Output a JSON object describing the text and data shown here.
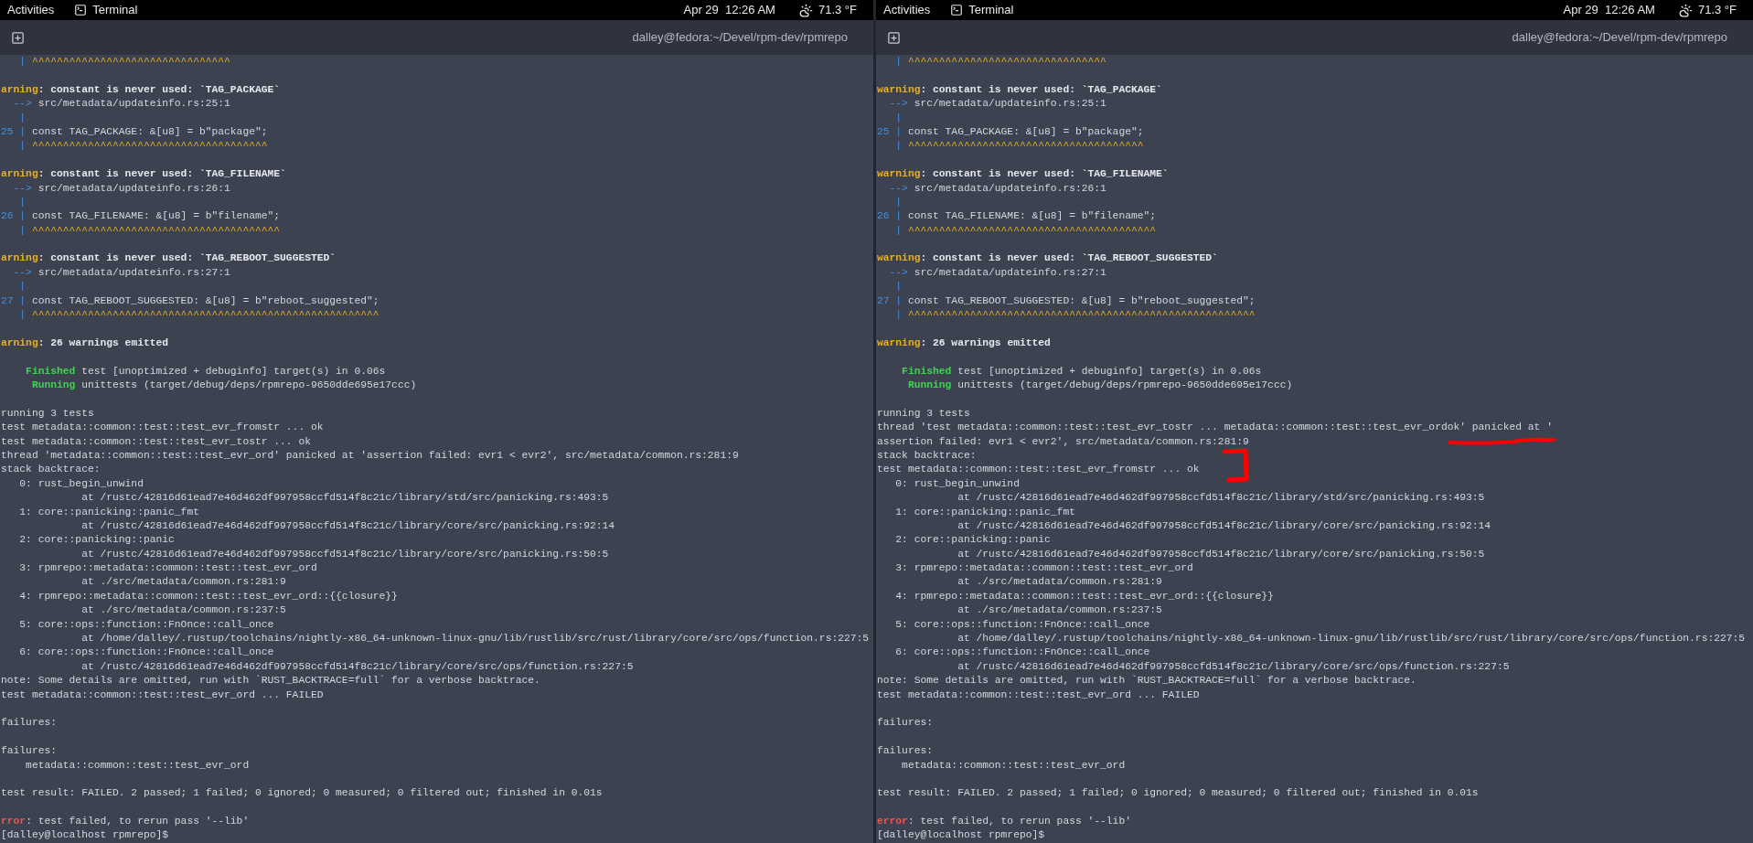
{
  "panes": [
    {
      "top_bar": {
        "activities": "Activities",
        "app": "Terminal",
        "datetime": "Apr 29  12:26 AM",
        "weather": "71.3 °F"
      },
      "header": {
        "title": "dalley@fedora:~/Devel/rpm-dev/rpmrepo"
      },
      "lines": [
        {
          "kind": "rich",
          "segments": [
            {
              "text": "   | ",
              "kind": "gutter"
            },
            {
              "text": "^^^^^^^^^^^^^^^^^^^^^^^^^^^^^^^^",
              "kind": "caret"
            }
          ]
        },
        {
          "kind": "blank"
        },
        {
          "kind": "rich",
          "segments": [
            {
              "text": "arning",
              "kind": "warning"
            },
            {
              "text": ": constant is never used: `TAG_PACKAGE`",
              "kind": "bold"
            }
          ]
        },
        {
          "kind": "rich",
          "segments": [
            {
              "text": "  -->",
              "kind": "gutter"
            },
            {
              "text": " src/metadata/updateinfo.rs:25:1",
              "kind": "plain"
            }
          ]
        },
        {
          "kind": "rich",
          "segments": [
            {
              "text": "   |",
              "kind": "gutter"
            }
          ]
        },
        {
          "kind": "rich",
          "segments": [
            {
              "text": "25 |",
              "kind": "gutter"
            },
            {
              "text": " const TAG_PACKAGE: &[u8] = b\"package\";",
              "kind": "plain"
            }
          ]
        },
        {
          "kind": "rich",
          "segments": [
            {
              "text": "   | ",
              "kind": "gutter"
            },
            {
              "text": "^^^^^^^^^^^^^^^^^^^^^^^^^^^^^^^^^^^^^^",
              "kind": "caret"
            }
          ]
        },
        {
          "kind": "blank"
        },
        {
          "kind": "rich",
          "segments": [
            {
              "text": "arning",
              "kind": "warning"
            },
            {
              "text": ": constant is never used: `TAG_FILENAME`",
              "kind": "bold"
            }
          ]
        },
        {
          "kind": "rich",
          "segments": [
            {
              "text": "  -->",
              "kind": "gutter"
            },
            {
              "text": " src/metadata/updateinfo.rs:26:1",
              "kind": "plain"
            }
          ]
        },
        {
          "kind": "rich",
          "segments": [
            {
              "text": "   |",
              "kind": "gutter"
            }
          ]
        },
        {
          "kind": "rich",
          "segments": [
            {
              "text": "26 |",
              "kind": "gutter"
            },
            {
              "text": " const TAG_FILENAME: &[u8] = b\"filename\";",
              "kind": "plain"
            }
          ]
        },
        {
          "kind": "rich",
          "segments": [
            {
              "text": "   | ",
              "kind": "gutter"
            },
            {
              "text": "^^^^^^^^^^^^^^^^^^^^^^^^^^^^^^^^^^^^^^^^",
              "kind": "caret"
            }
          ]
        },
        {
          "kind": "blank"
        },
        {
          "kind": "rich",
          "segments": [
            {
              "text": "arning",
              "kind": "warning"
            },
            {
              "text": ": constant is never used: `TAG_REBOOT_SUGGESTED`",
              "kind": "bold"
            }
          ]
        },
        {
          "kind": "rich",
          "segments": [
            {
              "text": "  -->",
              "kind": "gutter"
            },
            {
              "text": " src/metadata/updateinfo.rs:27:1",
              "kind": "plain"
            }
          ]
        },
        {
          "kind": "rich",
          "segments": [
            {
              "text": "   |",
              "kind": "gutter"
            }
          ]
        },
        {
          "kind": "rich",
          "segments": [
            {
              "text": "27 |",
              "kind": "gutter"
            },
            {
              "text": " const TAG_REBOOT_SUGGESTED: &[u8] = b\"reboot_suggested\";",
              "kind": "plain"
            }
          ]
        },
        {
          "kind": "rich",
          "segments": [
            {
              "text": "   | ",
              "kind": "gutter"
            },
            {
              "text": "^^^^^^^^^^^^^^^^^^^^^^^^^^^^^^^^^^^^^^^^^^^^^^^^^^^^^^^^",
              "kind": "caret"
            }
          ]
        },
        {
          "kind": "blank"
        },
        {
          "kind": "rich",
          "segments": [
            {
              "text": "arning",
              "kind": "warning"
            },
            {
              "text": ": 26 warnings emitted",
              "kind": "bold"
            }
          ]
        },
        {
          "kind": "blank"
        },
        {
          "kind": "rich",
          "segments": [
            {
              "text": "    Finished",
              "kind": "success"
            },
            {
              "text": " test [unoptimized + debuginfo] target(s) in 0.06s",
              "kind": "plain"
            }
          ]
        },
        {
          "kind": "rich",
          "segments": [
            {
              "text": "     Running",
              "kind": "success"
            },
            {
              "text": " unittests (target/debug/deps/rpmrepo-9650dde695e17ccc)",
              "kind": "plain"
            }
          ]
        },
        {
          "kind": "blank"
        },
        {
          "kind": "plain",
          "text": "running 3 tests"
        },
        {
          "kind": "plain",
          "text": "test metadata::common::test::test_evr_fromstr ... ok"
        },
        {
          "kind": "plain",
          "text": "test metadata::common::test::test_evr_tostr ... ok"
        },
        {
          "kind": "plain",
          "text": "thread 'metadata::common::test::test_evr_ord' panicked at 'assertion failed: evr1 < evr2', src/metadata/common.rs:281:9"
        },
        {
          "kind": "plain",
          "text": "stack backtrace:"
        },
        {
          "kind": "plain",
          "text": "   0: rust_begin_unwind"
        },
        {
          "kind": "plain",
          "text": "             at /rustc/42816d61ead7e46d462df997958ccfd514f8c21c/library/std/src/panicking.rs:493:5"
        },
        {
          "kind": "plain",
          "text": "   1: core::panicking::panic_fmt"
        },
        {
          "kind": "plain",
          "text": "             at /rustc/42816d61ead7e46d462df997958ccfd514f8c21c/library/core/src/panicking.rs:92:14"
        },
        {
          "kind": "plain",
          "text": "   2: core::panicking::panic"
        },
        {
          "kind": "plain",
          "text": "             at /rustc/42816d61ead7e46d462df997958ccfd514f8c21c/library/core/src/panicking.rs:50:5"
        },
        {
          "kind": "plain",
          "text": "   3: rpmrepo::metadata::common::test::test_evr_ord"
        },
        {
          "kind": "plain",
          "text": "             at ./src/metadata/common.rs:281:9"
        },
        {
          "kind": "plain",
          "text": "   4: rpmrepo::metadata::common::test::test_evr_ord::{{closure}}"
        },
        {
          "kind": "plain",
          "text": "             at ./src/metadata/common.rs:237:5"
        },
        {
          "kind": "plain",
          "text": "   5: core::ops::function::FnOnce::call_once"
        },
        {
          "kind": "plain",
          "text": "             at /home/dalley/.rustup/toolchains/nightly-x86_64-unknown-linux-gnu/lib/rustlib/src/rust/library/core/src/ops/function.rs:227:5"
        },
        {
          "kind": "plain",
          "text": "   6: core::ops::function::FnOnce::call_once"
        },
        {
          "kind": "plain",
          "text": "             at /rustc/42816d61ead7e46d462df997958ccfd514f8c21c/library/core/src/ops/function.rs:227:5"
        },
        {
          "kind": "plain",
          "text": "note: Some details are omitted, run with `RUST_BACKTRACE=full` for a verbose backtrace."
        },
        {
          "kind": "plain",
          "text": "test metadata::common::test::test_evr_ord ... FAILED"
        },
        {
          "kind": "blank"
        },
        {
          "kind": "plain",
          "text": "failures:"
        },
        {
          "kind": "blank"
        },
        {
          "kind": "plain",
          "text": "failures:"
        },
        {
          "kind": "plain",
          "text": "    metadata::common::test::test_evr_ord"
        },
        {
          "kind": "blank"
        },
        {
          "kind": "plain",
          "text": "test result: FAILED. 2 passed; 1 failed; 0 ignored; 0 measured; 0 filtered out; finished in 0.01s"
        },
        {
          "kind": "blank"
        },
        {
          "kind": "rich",
          "segments": [
            {
              "text": "rror",
              "kind": "error"
            },
            {
              "text": ": test failed, to rerun pass '--lib'",
              "kind": "plain"
            }
          ]
        },
        {
          "kind": "plain",
          "text": "[dalley@localhost rpmrepo]$"
        }
      ]
    },
    {
      "top_bar": {
        "activities": "Activities",
        "app": "Terminal",
        "datetime": "Apr 29  12:26 AM",
        "weather": "71.3 °F"
      },
      "header": {
        "title": "dalley@fedora:~/Devel/rpm-dev/rpmrepo"
      },
      "lines": [
        {
          "kind": "rich",
          "segments": [
            {
              "text": "   | ",
              "kind": "gutter"
            },
            {
              "text": "^^^^^^^^^^^^^^^^^^^^^^^^^^^^^^^^",
              "kind": "caret"
            }
          ]
        },
        {
          "kind": "blank"
        },
        {
          "kind": "rich",
          "segments": [
            {
              "text": "warning",
              "kind": "warning"
            },
            {
              "text": ": constant is never used: `TAG_PACKAGE`",
              "kind": "bold"
            }
          ]
        },
        {
          "kind": "rich",
          "segments": [
            {
              "text": "  -->",
              "kind": "gutter"
            },
            {
              "text": " src/metadata/updateinfo.rs:25:1",
              "kind": "plain"
            }
          ]
        },
        {
          "kind": "rich",
          "segments": [
            {
              "text": "   |",
              "kind": "gutter"
            }
          ]
        },
        {
          "kind": "rich",
          "segments": [
            {
              "text": "25 |",
              "kind": "gutter"
            },
            {
              "text": " const TAG_PACKAGE: &[u8] = b\"package\";",
              "kind": "plain"
            }
          ]
        },
        {
          "kind": "rich",
          "segments": [
            {
              "text": "   | ",
              "kind": "gutter"
            },
            {
              "text": "^^^^^^^^^^^^^^^^^^^^^^^^^^^^^^^^^^^^^^",
              "kind": "caret"
            }
          ]
        },
        {
          "kind": "blank"
        },
        {
          "kind": "rich",
          "segments": [
            {
              "text": "warning",
              "kind": "warning"
            },
            {
              "text": ": constant is never used: `TAG_FILENAME`",
              "kind": "bold"
            }
          ]
        },
        {
          "kind": "rich",
          "segments": [
            {
              "text": "  -->",
              "kind": "gutter"
            },
            {
              "text": " src/metadata/updateinfo.rs:26:1",
              "kind": "plain"
            }
          ]
        },
        {
          "kind": "rich",
          "segments": [
            {
              "text": "   |",
              "kind": "gutter"
            }
          ]
        },
        {
          "kind": "rich",
          "segments": [
            {
              "text": "26 |",
              "kind": "gutter"
            },
            {
              "text": " const TAG_FILENAME: &[u8] = b\"filename\";",
              "kind": "plain"
            }
          ]
        },
        {
          "kind": "rich",
          "segments": [
            {
              "text": "   | ",
              "kind": "gutter"
            },
            {
              "text": "^^^^^^^^^^^^^^^^^^^^^^^^^^^^^^^^^^^^^^^^",
              "kind": "caret"
            }
          ]
        },
        {
          "kind": "blank"
        },
        {
          "kind": "rich",
          "segments": [
            {
              "text": "warning",
              "kind": "warning"
            },
            {
              "text": ": constant is never used: `TAG_REBOOT_SUGGESTED`",
              "kind": "bold"
            }
          ]
        },
        {
          "kind": "rich",
          "segments": [
            {
              "text": "  -->",
              "kind": "gutter"
            },
            {
              "text": " src/metadata/updateinfo.rs:27:1",
              "kind": "plain"
            }
          ]
        },
        {
          "kind": "rich",
          "segments": [
            {
              "text": "   |",
              "kind": "gutter"
            }
          ]
        },
        {
          "kind": "rich",
          "segments": [
            {
              "text": "27 |",
              "kind": "gutter"
            },
            {
              "text": " const TAG_REBOOT_SUGGESTED: &[u8] = b\"reboot_suggested\";",
              "kind": "plain"
            }
          ]
        },
        {
          "kind": "rich",
          "segments": [
            {
              "text": "   | ",
              "kind": "gutter"
            },
            {
              "text": "^^^^^^^^^^^^^^^^^^^^^^^^^^^^^^^^^^^^^^^^^^^^^^^^^^^^^^^^",
              "kind": "caret"
            }
          ]
        },
        {
          "kind": "blank"
        },
        {
          "kind": "rich",
          "segments": [
            {
              "text": "warning",
              "kind": "warning"
            },
            {
              "text": ": 26 warnings emitted",
              "kind": "bold"
            }
          ]
        },
        {
          "kind": "blank"
        },
        {
          "kind": "rich",
          "segments": [
            {
              "text": "    Finished",
              "kind": "success"
            },
            {
              "text": " test [unoptimized + debuginfo] target(s) in 0.06s",
              "kind": "plain"
            }
          ]
        },
        {
          "kind": "rich",
          "segments": [
            {
              "text": "     Running",
              "kind": "success"
            },
            {
              "text": " unittests (target/debug/deps/rpmrepo-9650dde695e17ccc)",
              "kind": "plain"
            }
          ]
        },
        {
          "kind": "blank"
        },
        {
          "kind": "plain",
          "text": "running 3 tests"
        },
        {
          "kind": "plain",
          "text": "thread 'test metadata::common::test::test_evr_tostr ... metadata::common::test::test_evr_ordok' panicked at '",
          "mark": {
            "kind": "underline"
          }
        },
        {
          "kind": "plain",
          "text": "assertion failed: evr1 < evr2', src/metadata/common.rs:281:9"
        },
        {
          "kind": "plain",
          "text": "stack backtrace:",
          "mark": {
            "kind": "bracket"
          }
        },
        {
          "kind": "plain",
          "text": "test metadata::common::test::test_evr_fromstr ... ok"
        },
        {
          "kind": "plain",
          "text": "   0: rust_begin_unwind"
        },
        {
          "kind": "plain",
          "text": "             at /rustc/42816d61ead7e46d462df997958ccfd514f8c21c/library/std/src/panicking.rs:493:5"
        },
        {
          "kind": "plain",
          "text": "   1: core::panicking::panic_fmt"
        },
        {
          "kind": "plain",
          "text": "             at /rustc/42816d61ead7e46d462df997958ccfd514f8c21c/library/core/src/panicking.rs:92:14"
        },
        {
          "kind": "plain",
          "text": "   2: core::panicking::panic"
        },
        {
          "kind": "plain",
          "text": "             at /rustc/42816d61ead7e46d462df997958ccfd514f8c21c/library/core/src/panicking.rs:50:5"
        },
        {
          "kind": "plain",
          "text": "   3: rpmrepo::metadata::common::test::test_evr_ord"
        },
        {
          "kind": "plain",
          "text": "             at ./src/metadata/common.rs:281:9"
        },
        {
          "kind": "plain",
          "text": "   4: rpmrepo::metadata::common::test::test_evr_ord::{{closure}}"
        },
        {
          "kind": "plain",
          "text": "             at ./src/metadata/common.rs:237:5"
        },
        {
          "kind": "plain",
          "text": "   5: core::ops::function::FnOnce::call_once"
        },
        {
          "kind": "plain",
          "text": "             at /home/dalley/.rustup/toolchains/nightly-x86_64-unknown-linux-gnu/lib/rustlib/src/rust/library/core/src/ops/function.rs:227:5"
        },
        {
          "kind": "plain",
          "text": "   6: core::ops::function::FnOnce::call_once"
        },
        {
          "kind": "plain",
          "text": "             at /rustc/42816d61ead7e46d462df997958ccfd514f8c21c/library/core/src/ops/function.rs:227:5"
        },
        {
          "kind": "plain",
          "text": "note: Some details are omitted, run with `RUST_BACKTRACE=full` for a verbose backtrace."
        },
        {
          "kind": "plain",
          "text": "test metadata::common::test::test_evr_ord ... FAILED"
        },
        {
          "kind": "blank"
        },
        {
          "kind": "plain",
          "text": "failures:"
        },
        {
          "kind": "blank"
        },
        {
          "kind": "plain",
          "text": "failures:"
        },
        {
          "kind": "plain",
          "text": "    metadata::common::test::test_evr_ord"
        },
        {
          "kind": "blank"
        },
        {
          "kind": "plain",
          "text": "test result: FAILED. 2 passed; 1 failed; 0 ignored; 0 measured; 0 filtered out; finished in 0.01s"
        },
        {
          "kind": "blank"
        },
        {
          "kind": "rich",
          "segments": [
            {
              "text": "error",
              "kind": "error"
            },
            {
              "text": ": test failed, to rerun pass '--lib'",
              "kind": "plain"
            }
          ]
        },
        {
          "kind": "plain",
          "text": "[dalley@localhost rpmrepo]$"
        }
      ]
    }
  ]
}
